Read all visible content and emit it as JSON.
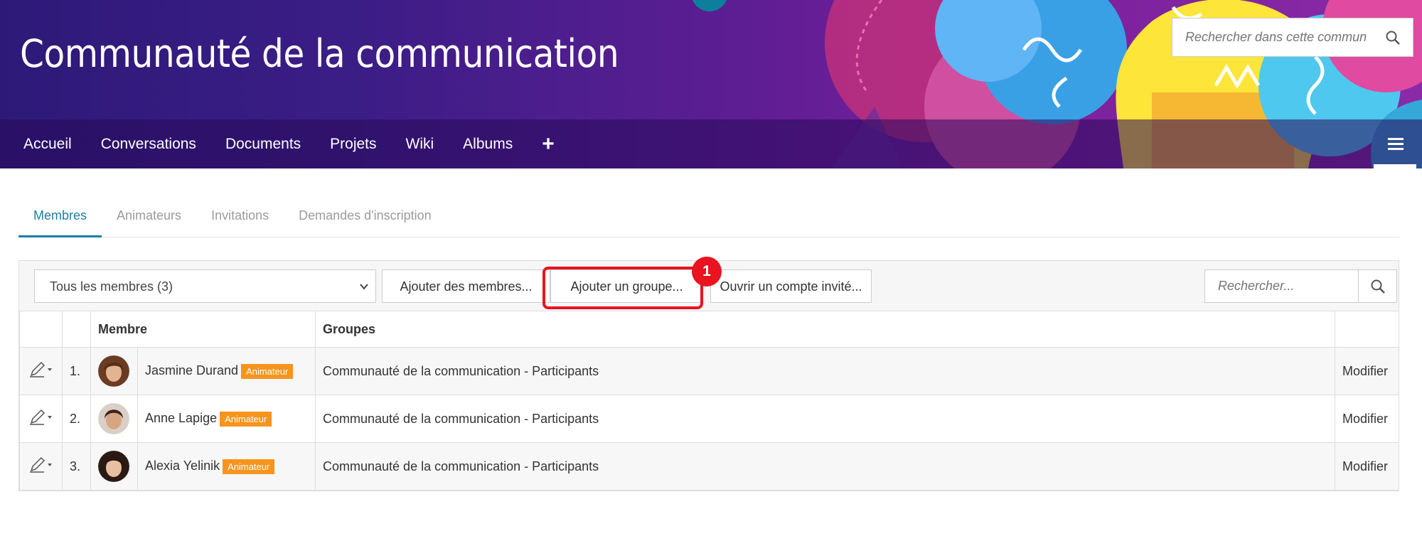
{
  "banner": {
    "title": "Communauté de la communication",
    "search_placeholder": "Rechercher dans cette commun"
  },
  "nav": {
    "items": [
      "Accueil",
      "Conversations",
      "Documents",
      "Projets",
      "Wiki",
      "Albums"
    ],
    "add_label": "+"
  },
  "tabs": [
    {
      "label": "Membres",
      "active": true
    },
    {
      "label": "Animateurs",
      "active": false
    },
    {
      "label": "Invitations",
      "active": false
    },
    {
      "label": "Demandes d'inscription",
      "active": false
    }
  ],
  "toolbar": {
    "filter_value": "Tous les membres (3)",
    "add_members_label": "Ajouter des membres...",
    "add_group_label": "Ajouter un groupe...",
    "guest_account_label": "Ouvrir un compte invité...",
    "search_placeholder": "Rechercher...",
    "callout_number": "1"
  },
  "table": {
    "headers": {
      "member": "Membre",
      "groups": "Groupes"
    },
    "rows": [
      {
        "num": "1.",
        "name": "Jasmine Durand",
        "role": "Animateur",
        "groups": "Communauté de la communication - Participants",
        "action": "Modifier"
      },
      {
        "num": "2.",
        "name": "Anne Lapige",
        "role": "Animateur",
        "groups": "Communauté de la communication - Participants",
        "action": "Modifier"
      },
      {
        "num": "3.",
        "name": "Alexia Yelinik",
        "role": "Animateur",
        "groups": "Communauté de la communication - Participants",
        "action": "Modifier"
      }
    ]
  },
  "colors": {
    "accent": "#1b7fa6",
    "role_badge": "#f7941d",
    "highlight": "#e8141f",
    "banner_dark": "#2d1a78"
  },
  "icons": [
    "menu-icon",
    "search-icon",
    "chevron-down-icon",
    "edit-pencil-icon"
  ]
}
